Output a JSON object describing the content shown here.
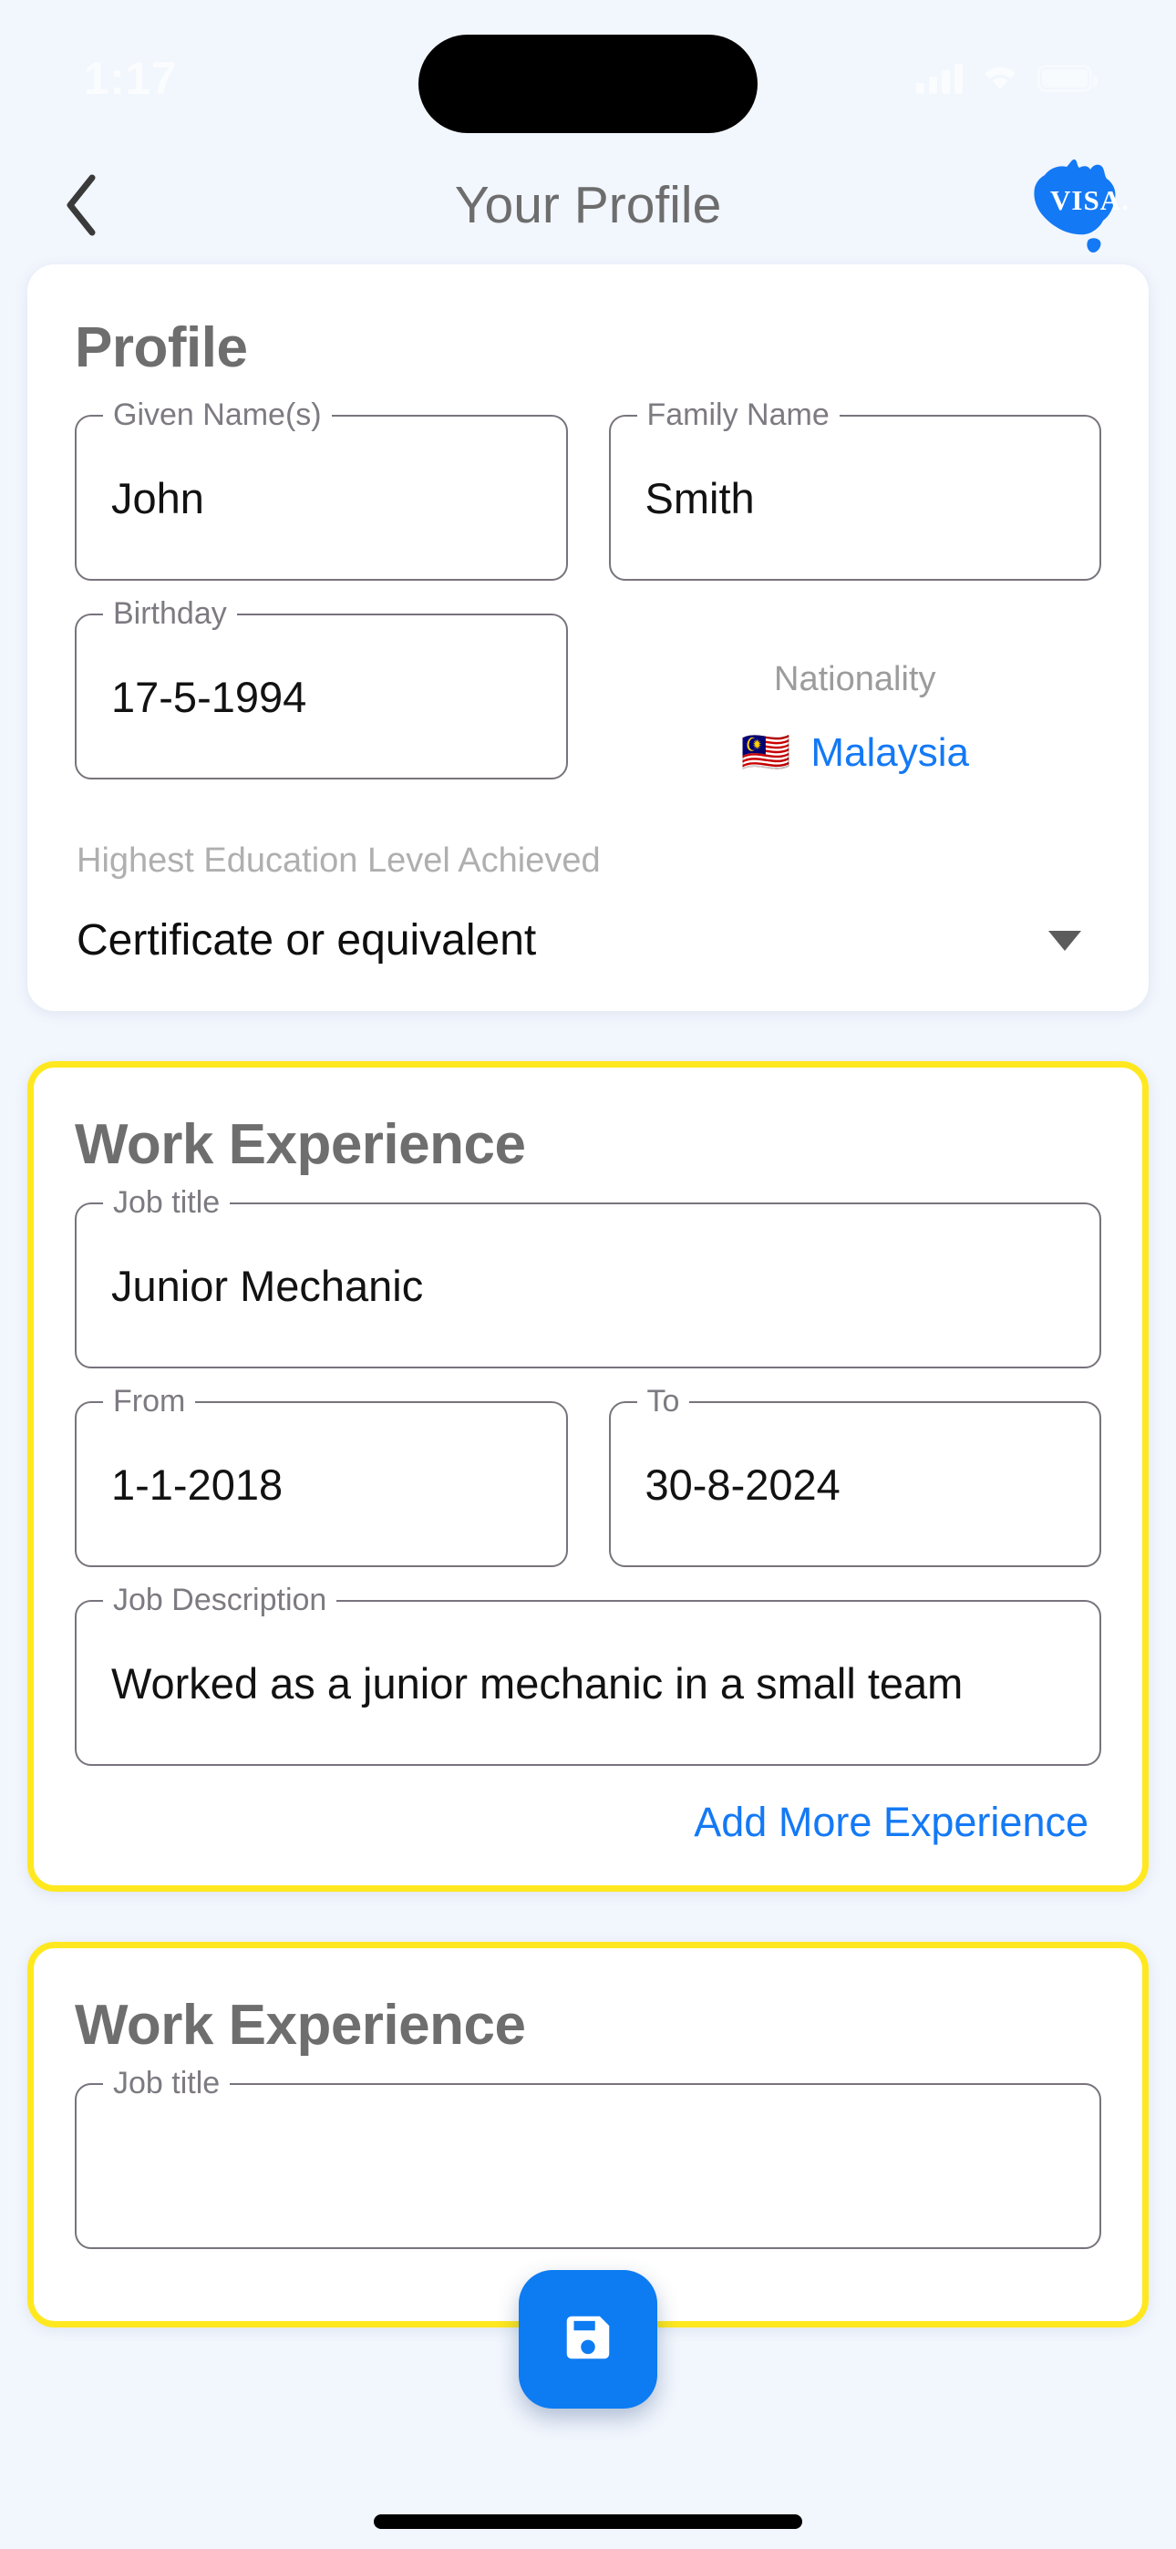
{
  "status_bar": {
    "time": "1:17",
    "icons": [
      "cellular-signal-icon",
      "wifi-icon",
      "battery-icon"
    ]
  },
  "header": {
    "back_icon": "chevron-left-icon",
    "title": "Your Profile",
    "logo_text": "VISA.",
    "logo_name": "australia-visa-logo"
  },
  "profile_card": {
    "title": "Profile",
    "fields": {
      "given_name": {
        "label": "Given Name(s)",
        "value": "John"
      },
      "family_name": {
        "label": "Family Name",
        "value": "Smith"
      },
      "birthday": {
        "label": "Birthday",
        "value": "17-5-1994"
      }
    },
    "nationality": {
      "label": "Nationality",
      "flag": "🇲🇾",
      "country": "Malaysia"
    },
    "education": {
      "label": "Highest Education Level Achieved",
      "value": "Certificate or equivalent",
      "caret_icon": "chevron-down-icon"
    }
  },
  "work_experience_1": {
    "title": "Work Experience",
    "fields": {
      "job_title": {
        "label": "Job title",
        "value": "Junior Mechanic"
      },
      "from": {
        "label": "From",
        "value": "1-1-2018"
      },
      "to": {
        "label": "To",
        "value": "30-8-2024"
      },
      "description": {
        "label": "Job Description",
        "value": "Worked as a junior mechanic in a small team"
      }
    },
    "add_link": "Add More Experience"
  },
  "work_experience_2": {
    "title": "Work Experience",
    "fields": {
      "job_title": {
        "label": "Job title",
        "value": ""
      }
    }
  },
  "fab": {
    "name": "save-button",
    "icon": "save-floppy-icon"
  },
  "colors": {
    "background": "#F2F6FD",
    "accent_blue": "#1479F5",
    "highlight_yellow": "#FFE81F",
    "fab_blue": "#0D7CF2",
    "title_gray": "#6D6D6D",
    "field_border": "#78737C"
  }
}
